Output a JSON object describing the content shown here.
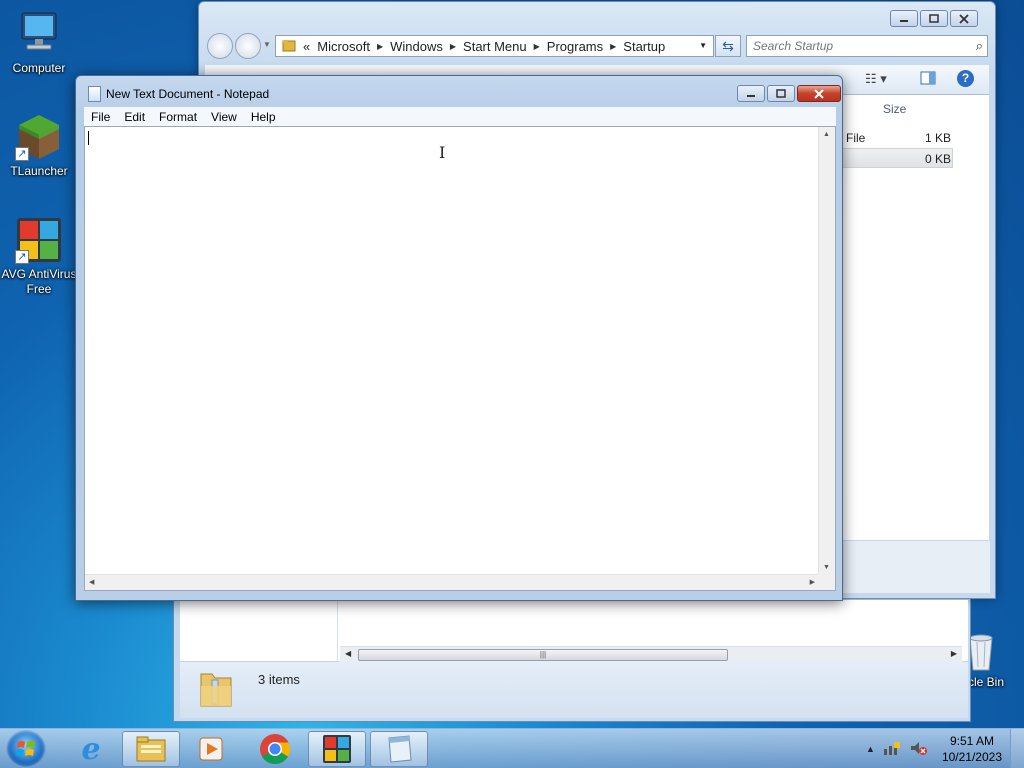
{
  "desktop": {
    "icons": [
      {
        "label": "Computer"
      },
      {
        "label": "TLauncher"
      },
      {
        "label": "AVG AntiVirus Free"
      },
      {
        "label": "cle Bin"
      }
    ]
  },
  "explorer": {
    "address": {
      "overflow": "«",
      "crumbs": [
        "Microsoft",
        "Windows",
        "Start Menu",
        "Programs",
        "Startup"
      ]
    },
    "search_placeholder": "Search Startup",
    "columns": {
      "size": "Size"
    },
    "rows": [
      {
        "type_fragment": "File",
        "size": "1 KB"
      },
      {
        "type_fragment": "",
        "size": "0 KB"
      }
    ],
    "status": {
      "item_count": "3 items"
    },
    "scroll_grip": "|||"
  },
  "notepad": {
    "title": "New Text Document - Notepad",
    "menu": [
      "File",
      "Edit",
      "Format",
      "View",
      "Help"
    ],
    "content": ""
  },
  "taskbar": {
    "clock": {
      "time": "9:51 AM",
      "date": "10/21/2023"
    },
    "buttons": [
      {
        "name": "internet-explorer"
      },
      {
        "name": "file-explorer"
      },
      {
        "name": "media-player"
      },
      {
        "name": "chrome"
      },
      {
        "name": "avg"
      },
      {
        "name": "notepad"
      }
    ]
  },
  "colors": {
    "accent": "#1b8bd0",
    "close_red": "#c7412b"
  }
}
